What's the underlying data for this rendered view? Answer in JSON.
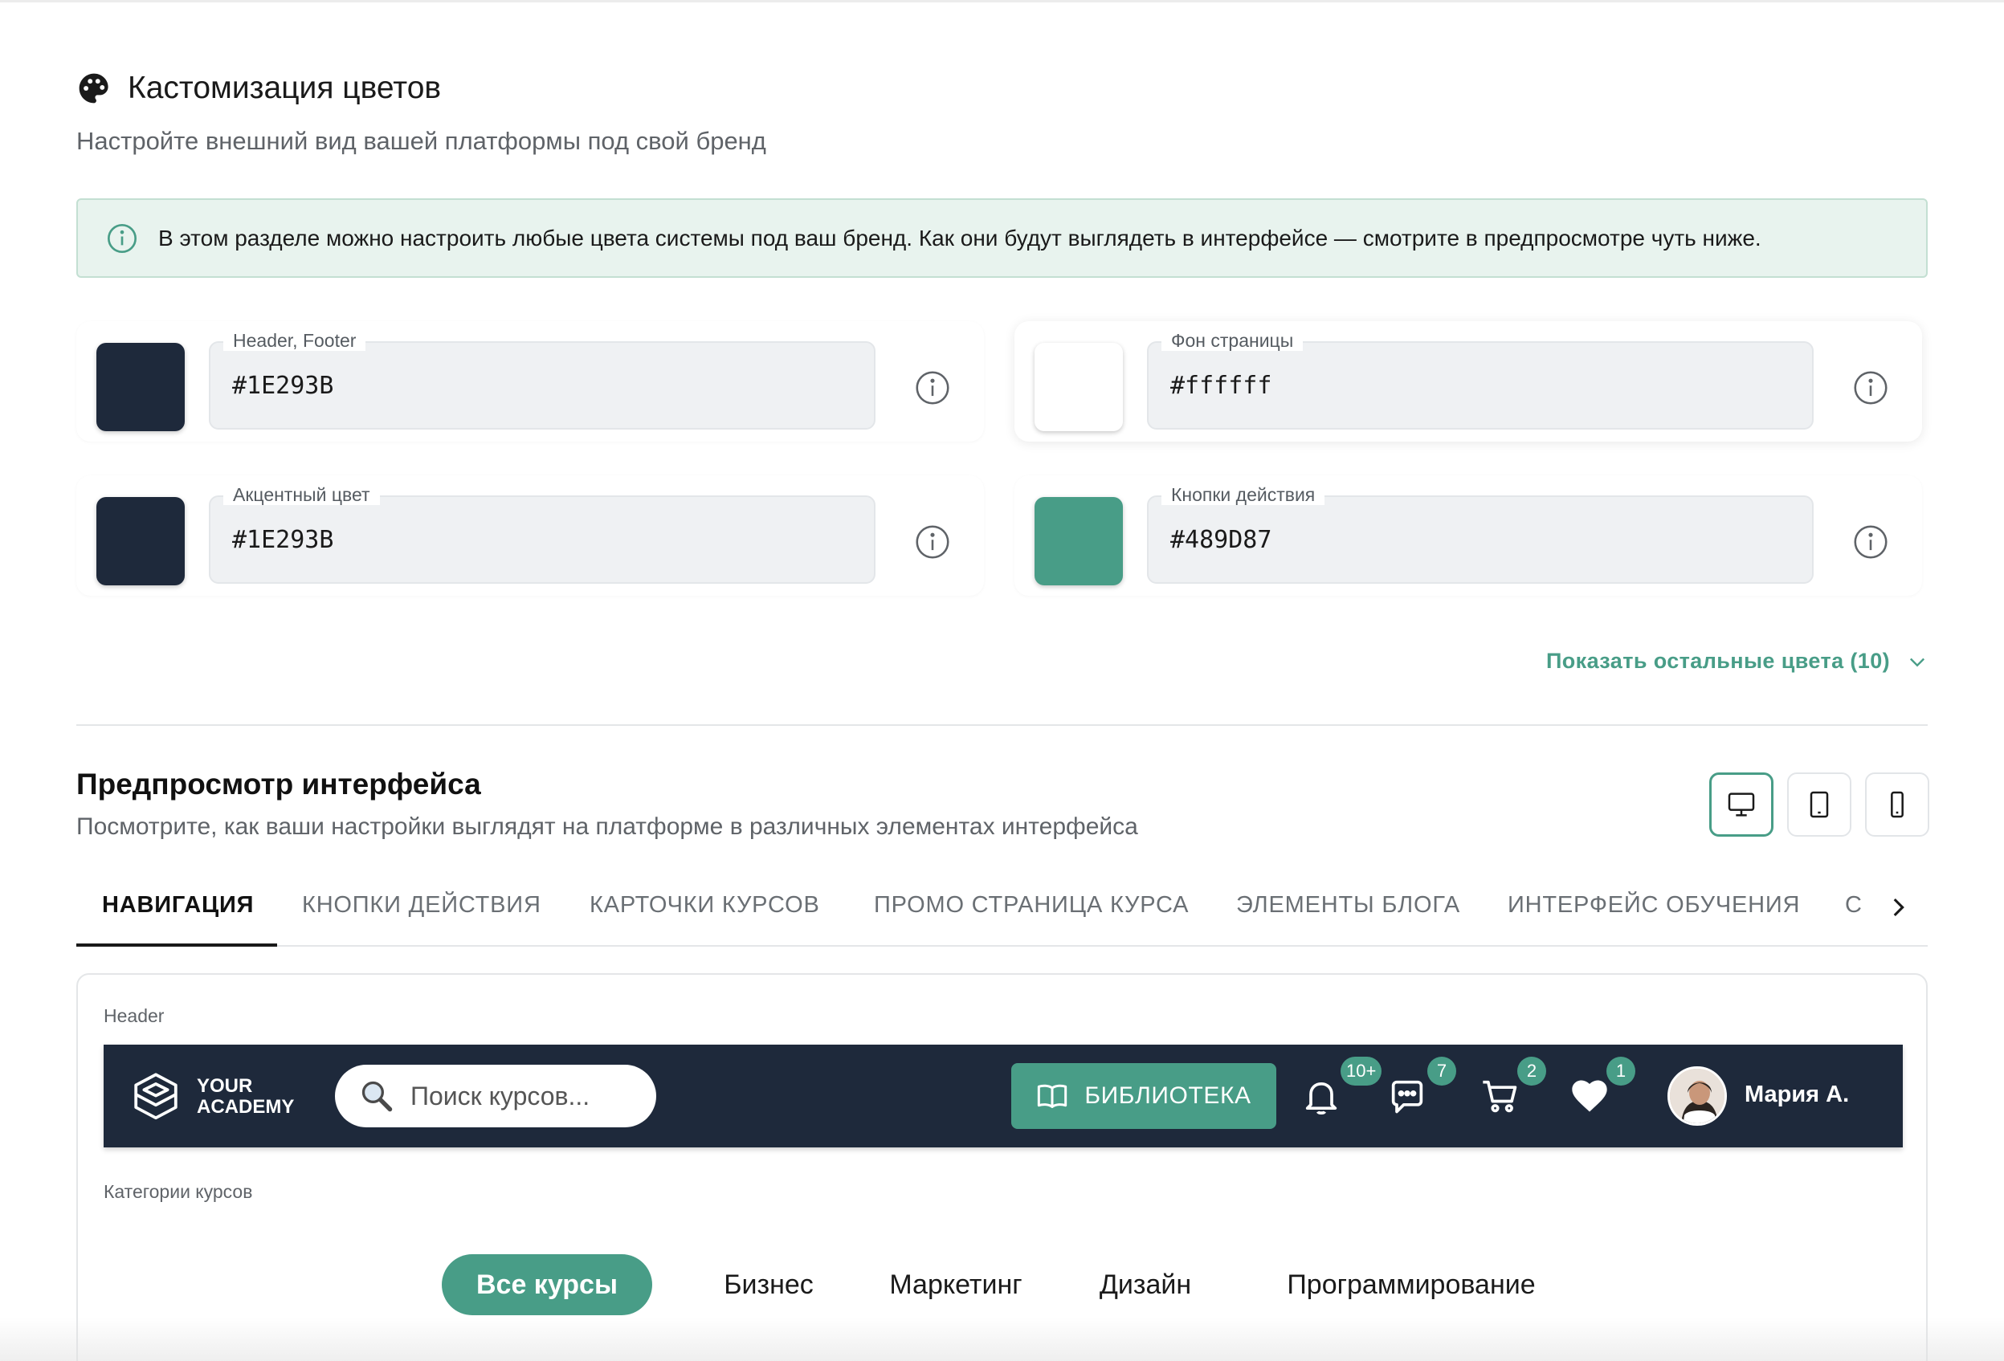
{
  "section": {
    "title": "Кастомизация цветов",
    "subtitle": "Настройте внешний вид вашей платформы под свой бренд",
    "icon": "palette-icon"
  },
  "banner": {
    "text": "В этом разделе можно настроить любые цвета системы под ваш бренд. Как они будут выглядеть в интерфейсе — смотрите в предпросмотре чуть ниже.",
    "icon": "info-icon"
  },
  "colors": [
    {
      "label": "Header, Footer",
      "value": "#1E293B",
      "swatch": "#1e293b"
    },
    {
      "label": "Фон страницы",
      "value": "#ffffff",
      "swatch": "#ffffff"
    },
    {
      "label": "Акцентный цвет",
      "value": "#1E293B",
      "swatch": "#1e293b"
    },
    {
      "label": "Кнопки действия",
      "value": "#489D87",
      "swatch": "#489d87"
    }
  ],
  "show_more": {
    "label": "Показать остальные цвета (10)"
  },
  "preview": {
    "title": "Предпросмотр интерфейса",
    "subtitle": "Посмотрите, как ваши настройки выглядят на платформе в различных элементах интерфейса",
    "devices": [
      "desktop-icon",
      "tablet-icon",
      "phone-icon"
    ],
    "active_device": "desktop-icon"
  },
  "tabs": [
    {
      "label": "НАВИГАЦИЯ",
      "active": true
    },
    {
      "label": "КНОПКИ ДЕЙСТВИЯ"
    },
    {
      "label": "КАРТОЧКИ КУРСОВ"
    },
    {
      "label": "ПРОМО СТРАНИЦА КУРСА"
    },
    {
      "label": "ЭЛЕМЕНТЫ БЛОГА"
    },
    {
      "label": "ИНТЕРФЕЙС ОБУЧЕНИЯ"
    },
    {
      "label": "С"
    }
  ],
  "panel": {
    "header_label": "Header",
    "categories_label": "Категории курсов"
  },
  "header": {
    "logo_line1": "YOUR",
    "logo_line2": "ACADEMY",
    "search_placeholder": "Поиск курсов...",
    "library_button": "БИБЛИОТЕКА",
    "badges": {
      "notifications": "10+",
      "messages": "7",
      "cart": "2",
      "favorites": "1"
    },
    "user_name": "Мария А.",
    "bg_color": "#1E293B",
    "accent_color": "#489D87"
  },
  "categories": [
    {
      "label": "Все курсы",
      "active": true
    },
    {
      "label": "Бизнес"
    },
    {
      "label": "Маркетинг"
    },
    {
      "label": "Дизайн"
    },
    {
      "label": "Программирование"
    }
  ]
}
